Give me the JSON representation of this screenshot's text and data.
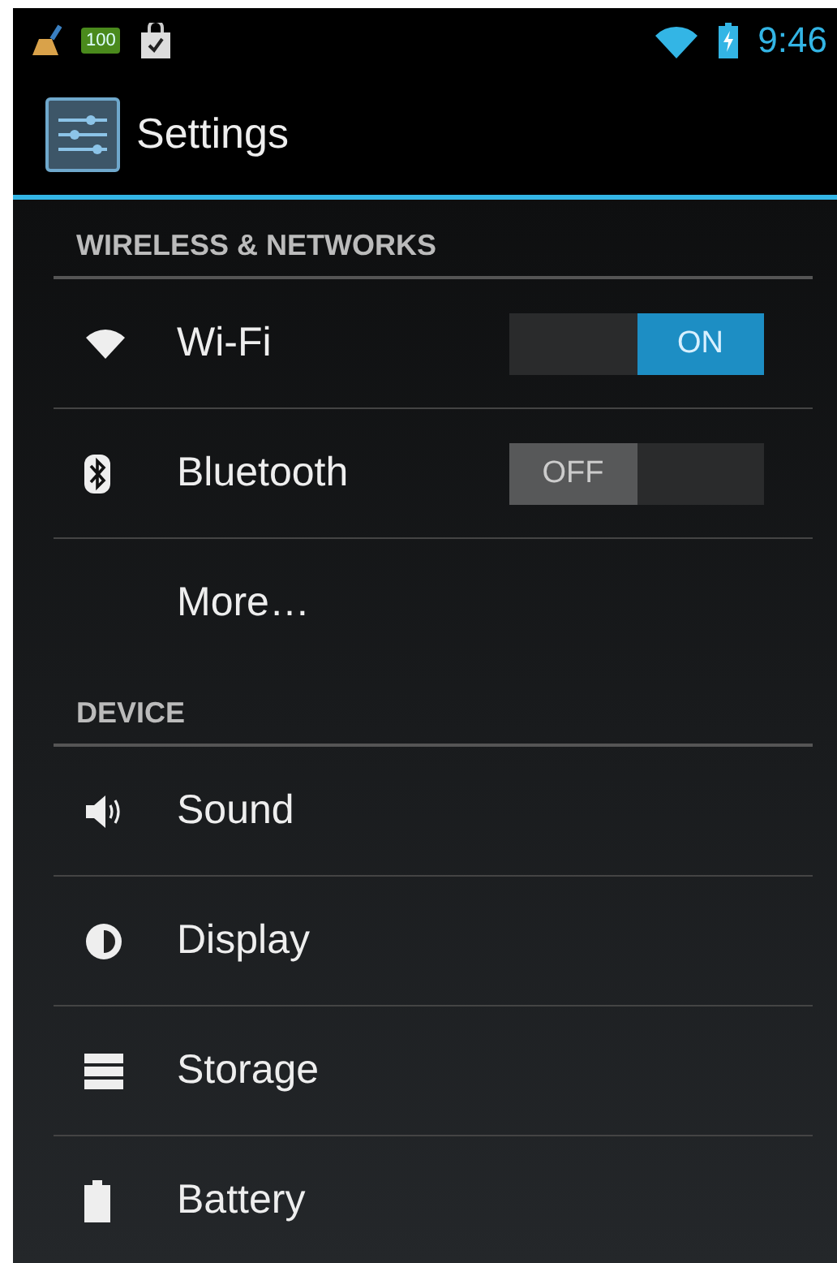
{
  "status_bar": {
    "battery_badge": "100",
    "time": "9:46"
  },
  "action_bar": {
    "title": "Settings"
  },
  "sections": [
    {
      "title": "WIRELESS & NETWORKS",
      "items": [
        {
          "kind": "toggle",
          "label": "Wi-Fi",
          "on": true,
          "switch_text": "ON"
        },
        {
          "kind": "toggle",
          "label": "Bluetooth",
          "on": false,
          "switch_text": "OFF"
        },
        {
          "kind": "link",
          "label": "More…"
        }
      ]
    },
    {
      "title": "DEVICE",
      "items": [
        {
          "kind": "link",
          "label": "Sound"
        },
        {
          "kind": "link",
          "label": "Display"
        },
        {
          "kind": "link",
          "label": "Storage"
        },
        {
          "kind": "link",
          "label": "Battery"
        }
      ]
    }
  ]
}
